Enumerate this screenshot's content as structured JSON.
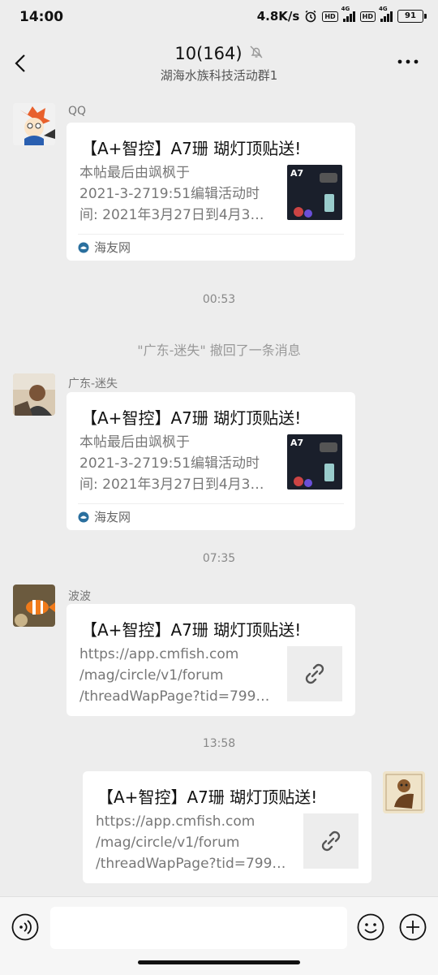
{
  "statusbar": {
    "time": "14:00",
    "speed": "4.8K/s",
    "hd": "HD",
    "net": "4G",
    "battery": "91"
  },
  "header": {
    "title": "10(164)",
    "subtitle": "湖海水族科技活动群1"
  },
  "messages": [
    {
      "sender": "QQ",
      "title": "【A+智控】A7珊 瑚灯顶贴送!",
      "desc": [
        "本帖最后由飒枫于",
        "2021-3-2719:51编辑活动时",
        "间: 2021年3月27日到4月3…"
      ],
      "thumb_label": "A7",
      "source": "海友网"
    },
    {
      "sender": "广东-迷失",
      "title": "【A+智控】A7珊 瑚灯顶贴送!",
      "desc": [
        "本帖最后由飒枫于",
        "2021-3-2719:51编辑活动时",
        "间: 2021年3月27日到4月3…"
      ],
      "thumb_label": "A7",
      "source": "海友网"
    },
    {
      "sender": "波波",
      "title": "【A+智控】A7珊 瑚灯顶贴送!",
      "desc": [
        "https://app.cmfish.com",
        "/mag/circle/v1/forum",
        "/threadWapPage?tid=799…"
      ]
    },
    {
      "title": "【A+智控】A7珊 瑚灯顶贴送!",
      "desc": [
        "https://app.cmfish.com",
        "/mag/circle/v1/forum",
        "/threadWapPage?tid=799…"
      ]
    }
  ],
  "timestamps": [
    "00:53",
    "07:35",
    "13:58"
  ],
  "recall": "\"广东-迷失\" 撤回了一条消息",
  "input": {
    "placeholder": ""
  },
  "colors": {
    "background": "#ededed",
    "bubble": "#ffffff",
    "source_icon": "#2a6f9e"
  }
}
